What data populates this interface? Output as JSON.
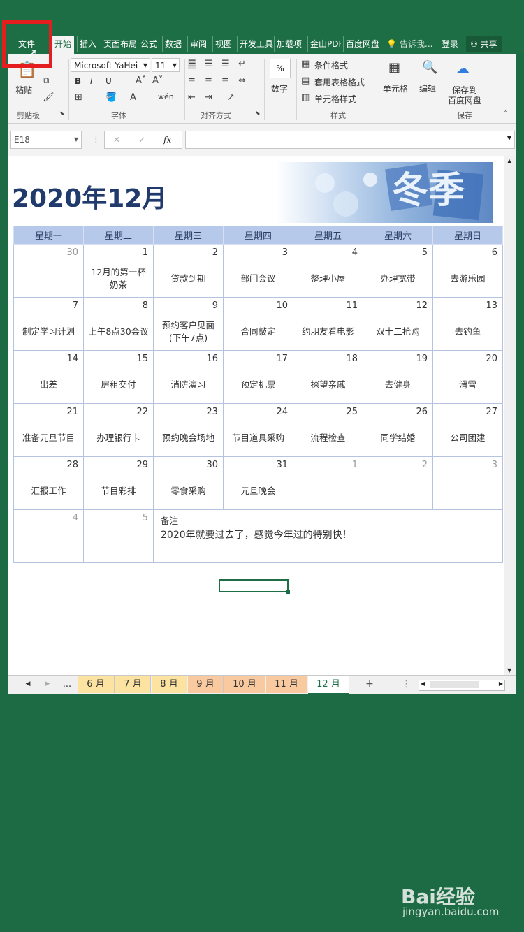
{
  "ribbon_tabs": {
    "file": "文件",
    "home": "开始",
    "insert": "插入",
    "page_layout": "页面布局",
    "formulas": "公式",
    "data": "数据",
    "review": "审阅",
    "view": "视图",
    "developer": "开发工具",
    "addins": "加载项",
    "kingsoft_pdf": "金山PDF",
    "baidu": "百度网盘",
    "tell_me": "告诉我...",
    "login": "登录",
    "share": "共享"
  },
  "ribbon": {
    "paste": "粘贴",
    "clipboard": "剪贴板",
    "font_name": "Microsoft YaHei",
    "font_size": "11",
    "font_group": "字体",
    "bold": "B",
    "italic": "I",
    "underline": "U",
    "align_group": "对齐方式",
    "number": "数字",
    "percent": "%",
    "cond_format": "条件格式",
    "table_format": "套用表格格式",
    "cell_style": "单元格样式",
    "styles_group": "样式",
    "cells": "单元格",
    "editing": "编辑",
    "save_baidu_line1": "保存到",
    "save_baidu_line2": "百度网盘",
    "save_group": "保存"
  },
  "formula_bar": {
    "name_box": "E18",
    "fx": "fx",
    "formula": ""
  },
  "calendar": {
    "title": "2020年12月",
    "banner_text": "冬季",
    "weekdays": [
      "星期一",
      "星期二",
      "星期三",
      "星期四",
      "星期五",
      "星期六",
      "星期日"
    ],
    "weeks": [
      [
        {
          "day": "30",
          "event": "",
          "other": true
        },
        {
          "day": "1",
          "event": "12月的第一杯\n奶茶"
        },
        {
          "day": "2",
          "event": "贷款到期"
        },
        {
          "day": "3",
          "event": "部门会议"
        },
        {
          "day": "4",
          "event": "整理小屋"
        },
        {
          "day": "5",
          "event": "办理宽带"
        },
        {
          "day": "6",
          "event": "去游乐园"
        }
      ],
      [
        {
          "day": "7",
          "event": "制定学习计划"
        },
        {
          "day": "8",
          "event": "上午8点30会议"
        },
        {
          "day": "9",
          "event": "预约客户见面\n(下午7点)"
        },
        {
          "day": "10",
          "event": "合同敲定"
        },
        {
          "day": "11",
          "event": "约朋友看电影"
        },
        {
          "day": "12",
          "event": "双十二抢购"
        },
        {
          "day": "13",
          "event": "去钓鱼"
        }
      ],
      [
        {
          "day": "14",
          "event": "出差"
        },
        {
          "day": "15",
          "event": "房租交付"
        },
        {
          "day": "16",
          "event": "消防演习"
        },
        {
          "day": "17",
          "event": "预定机票"
        },
        {
          "day": "18",
          "event": "探望亲戚"
        },
        {
          "day": "19",
          "event": "去健身"
        },
        {
          "day": "20",
          "event": "滑雪"
        }
      ],
      [
        {
          "day": "21",
          "event": "准备元旦节目"
        },
        {
          "day": "22",
          "event": "办理银行卡"
        },
        {
          "day": "23",
          "event": "预约晚会场地"
        },
        {
          "day": "24",
          "event": "节目道具采购"
        },
        {
          "day": "25",
          "event": "流程检查"
        },
        {
          "day": "26",
          "event": "同学结婚"
        },
        {
          "day": "27",
          "event": "公司团建"
        }
      ],
      [
        {
          "day": "28",
          "event": "汇报工作"
        },
        {
          "day": "29",
          "event": "节目彩排"
        },
        {
          "day": "30",
          "event": "零食采购"
        },
        {
          "day": "31",
          "event": "元旦晚会"
        },
        {
          "day": "1",
          "event": "",
          "other": true
        },
        {
          "day": "2",
          "event": "",
          "other": true
        },
        {
          "day": "3",
          "event": "",
          "other": true
        }
      ]
    ],
    "last_row": {
      "d1": "4",
      "d2": "5",
      "notes_label": "备注",
      "notes_text": "2020年就要过去了，感觉今年过的特别快！"
    }
  },
  "sheet_tabs": {
    "ellipsis": "...",
    "tabs": [
      {
        "label": "6 月",
        "color": "#fde3a1"
      },
      {
        "label": "7 月",
        "color": "#fde3a1"
      },
      {
        "label": "8 月",
        "color": "#fde3a1"
      },
      {
        "label": "9 月",
        "color": "#f9c9a0"
      },
      {
        "label": "10 月",
        "color": "#f9c9a0"
      },
      {
        "label": "11 月",
        "color": "#f9c9a0"
      },
      {
        "label": "12 月",
        "color": "#ffffff"
      }
    ],
    "add": "+"
  },
  "watermark": {
    "logo": "Bai经验",
    "url": "jingyan.baidu.com"
  },
  "colors": {
    "excel_green": "#1e6e45",
    "title_blue": "#1f3a6b",
    "header_blue": "#b7c9ea",
    "highlight_red": "#e41e1e"
  }
}
